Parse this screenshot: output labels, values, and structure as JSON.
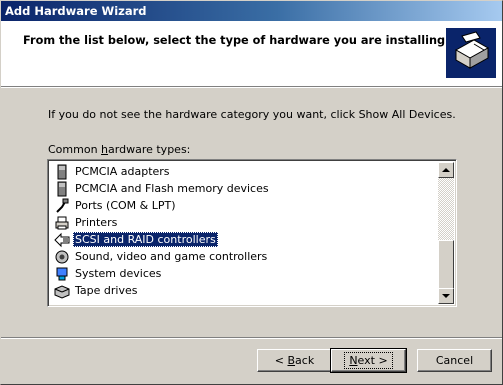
{
  "window": {
    "title": "Add Hardware Wizard"
  },
  "header": {
    "title": "From the list below, select the type of hardware you are installing"
  },
  "info_text": "If you do not see the hardware category you want, click Show All Devices.",
  "list": {
    "label": "Common hardware types:",
    "selected_index": 4,
    "items": [
      {
        "label": "PCMCIA adapters",
        "icon": "pcmcia-icon"
      },
      {
        "label": "PCMCIA and Flash memory devices",
        "icon": "pcmcia-icon"
      },
      {
        "label": "Ports (COM & LPT)",
        "icon": "port-icon"
      },
      {
        "label": "Printers",
        "icon": "printer-icon"
      },
      {
        "label": "SCSI and RAID controllers",
        "icon": "scsi-icon"
      },
      {
        "label": "Sound, video and game controllers",
        "icon": "sound-icon"
      },
      {
        "label": "System devices",
        "icon": "system-icon"
      },
      {
        "label": "Tape drives",
        "icon": "tape-icon"
      }
    ]
  },
  "buttons": {
    "back": "< Back",
    "next": "Next >",
    "cancel": "Cancel"
  },
  "colors": {
    "selection": "#0a246a",
    "dialog_bg": "#d4d0c8",
    "title_start": "#0a246a",
    "title_end": "#a6caf0"
  }
}
